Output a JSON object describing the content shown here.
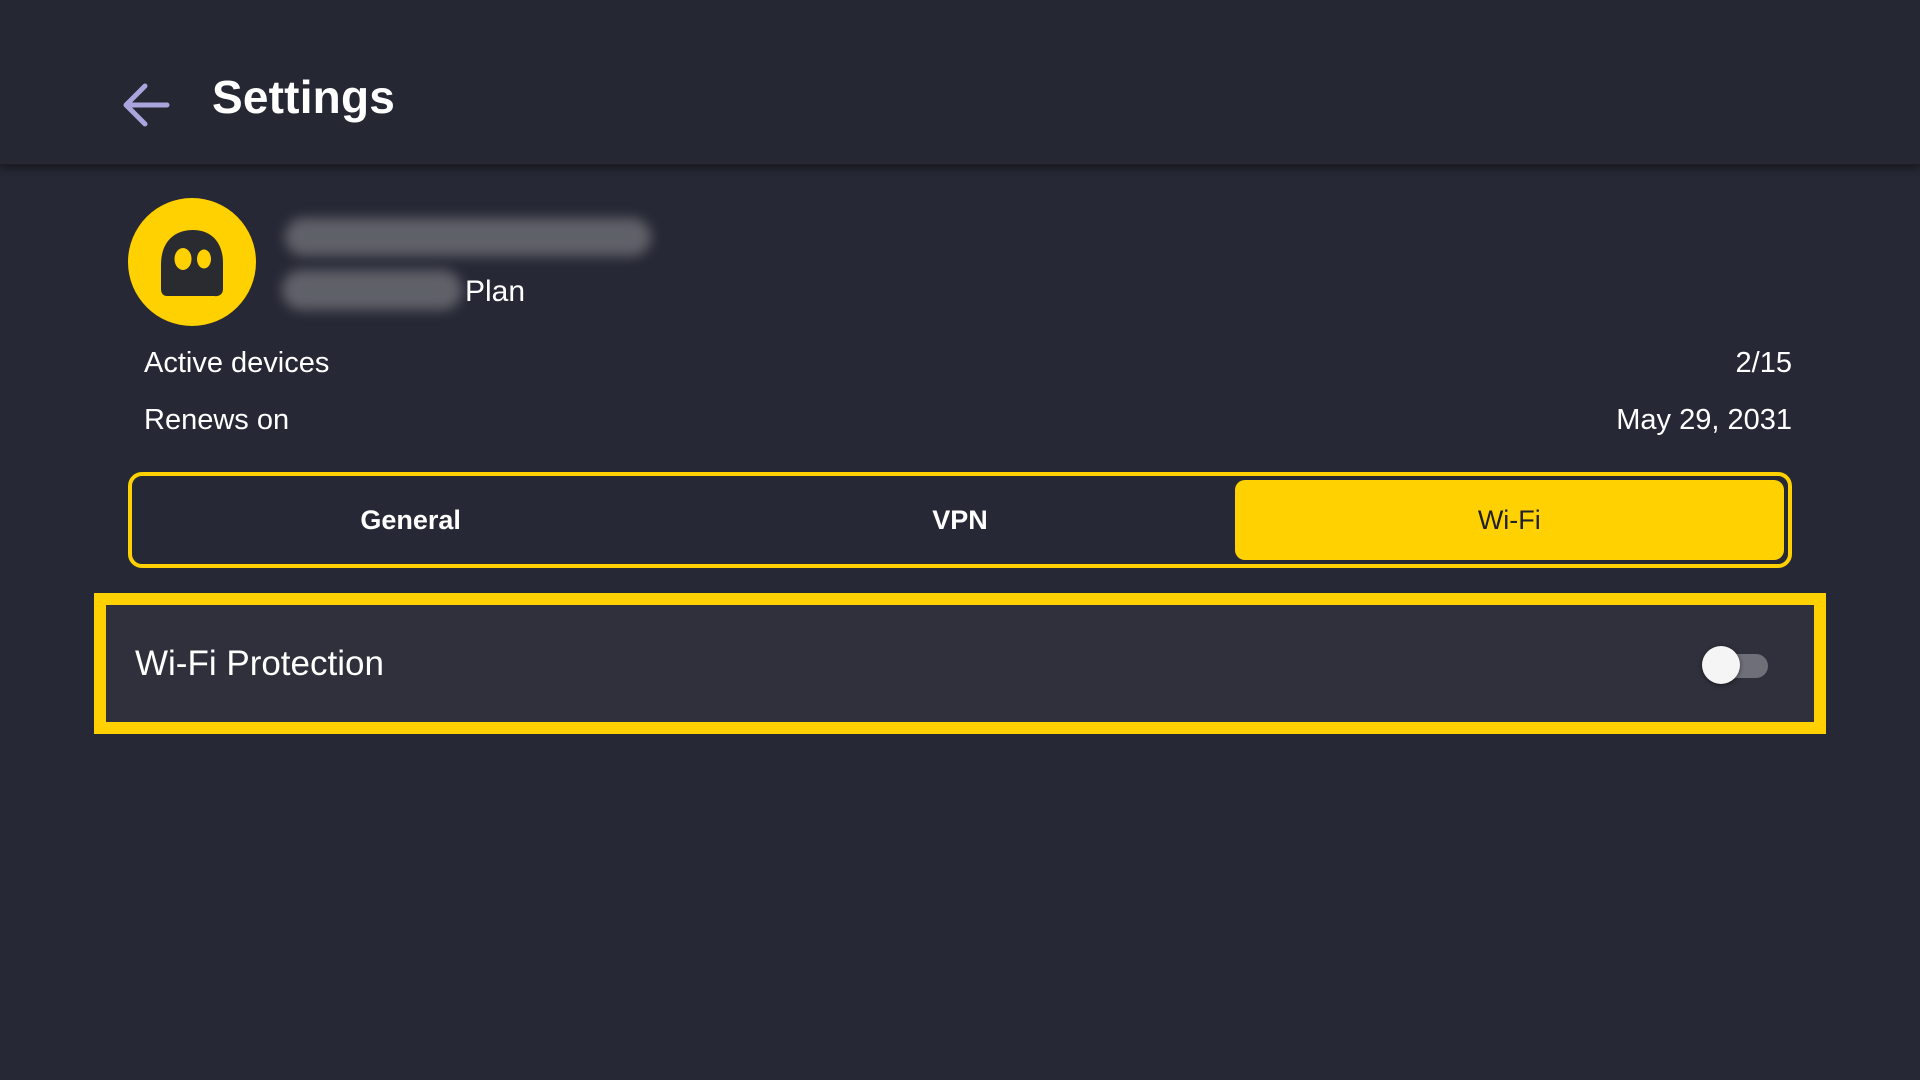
{
  "header": {
    "title": "Settings",
    "back_icon": "arrow-left-icon"
  },
  "account": {
    "avatar_icon": "ghost-logo-icon",
    "plan_suffix": "Plan",
    "active_devices_label": "Active devices",
    "active_devices_value": "2/15",
    "renews_label": "Renews on",
    "renews_value": "May 29, 2031"
  },
  "tabs": [
    {
      "label": "General",
      "active": false
    },
    {
      "label": "VPN",
      "active": false
    },
    {
      "label": "Wi-Fi",
      "active": true
    }
  ],
  "settings": {
    "wifi_protection": {
      "label": "Wi-Fi Protection",
      "enabled": false
    }
  },
  "colors": {
    "accent": "#ffd100",
    "background": "#262835",
    "row_background": "#2f303c",
    "back_icon": "#a9a6dd"
  }
}
